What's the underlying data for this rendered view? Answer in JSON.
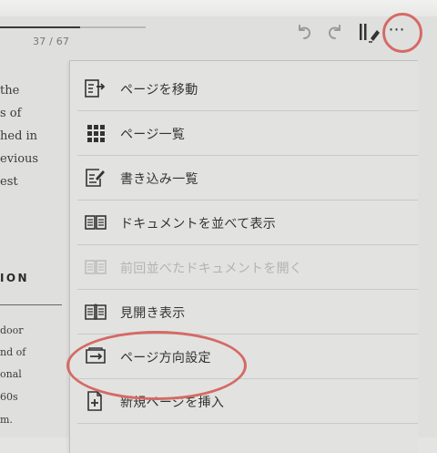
{
  "reader": {
    "page_counter": "37 / 67",
    "progress_fraction": 0.55
  },
  "toolbar": {
    "more_label": "⋯",
    "icons": [
      "undo-icon",
      "redo-icon",
      "pen-tools-icon",
      "more-icon"
    ]
  },
  "book": {
    "lines": [
      "the",
      "s of",
      "hed in",
      "evious",
      "est"
    ],
    "heading": "ION",
    "lines2": [
      "door",
      "nd of",
      "onal",
      "60s",
      "m."
    ]
  },
  "menu": {
    "items": [
      {
        "label": "ページを移動",
        "icon": "go-to-page-icon",
        "enabled": true
      },
      {
        "label": "ページ一覧",
        "icon": "grid-icon",
        "enabled": true
      },
      {
        "label": "書き込み一覧",
        "icon": "annotation-list-icon",
        "enabled": true
      },
      {
        "label": "ドキュメントを並べて表示",
        "icon": "side-by-side-icon",
        "enabled": true
      },
      {
        "label": "前回並べたドキュメントを開く",
        "icon": "reopen-side-by-side-icon",
        "enabled": false
      },
      {
        "label": "見開き表示",
        "icon": "open-book-icon",
        "enabled": true
      },
      {
        "label": "ページ方向設定",
        "icon": "page-direction-icon",
        "enabled": true
      },
      {
        "label": "新規ページを挿入",
        "icon": "insert-page-icon",
        "enabled": true
      }
    ]
  },
  "colors": {
    "highlight_circle": "#d56a66",
    "screen_bg": "#dfe0dd"
  }
}
